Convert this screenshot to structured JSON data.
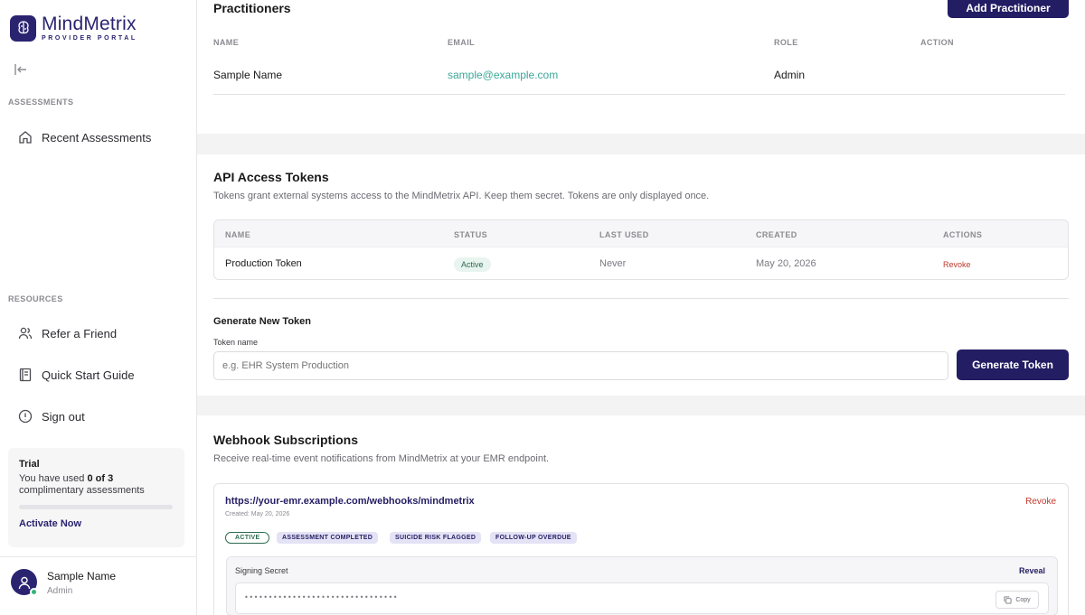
{
  "brand": {
    "name": "MindMetrix",
    "subtitle": "PROVIDER PORTAL"
  },
  "sidebar": {
    "assessments_label": "ASSESSMENTS",
    "recent_assessments": "Recent Assessments",
    "resources_label": "RESOURCES",
    "refer_friend": "Refer a Friend",
    "quick_start": "Quick Start Guide",
    "sign_out": "Sign out",
    "trial": {
      "title": "Trial",
      "text_prefix": "You have used",
      "used": "0 of 3",
      "text_suffix": "complimentary assessments",
      "progress": 0,
      "action": "Activate Now"
    },
    "user": {
      "name": "Sample Name",
      "role": "Admin",
      "status_color": "#2fb57a"
    }
  },
  "practitioners": {
    "title": "Practitioners",
    "add_button": "Add Practitioner",
    "columns": [
      "NAME",
      "EMAIL",
      "ROLE",
      "ACTION"
    ],
    "rows": [
      {
        "name": "Sample Name",
        "email": "sample@example.com",
        "role": "Admin"
      }
    ]
  },
  "tokens": {
    "title": "API Access Tokens",
    "description": "Tokens grant external systems access to the MindMetrix API. Keep them secret. Tokens are only displayed once.",
    "columns": [
      "NAME",
      "STATUS",
      "LAST USED",
      "CREATED",
      "ACTIONS"
    ],
    "rows": [
      {
        "name": "Production Token",
        "status": "Active",
        "last_used": "Never",
        "created": "May 20, 2026",
        "action": "Revoke"
      }
    ],
    "generate": {
      "title": "Generate New Token",
      "field_label": "Token name",
      "placeholder": "e.g. EHR System Production",
      "button": "Generate Token"
    }
  },
  "webhooks": {
    "title": "Webhook Subscriptions",
    "description": "Receive real-time event notifications from MindMetrix at your EMR endpoint.",
    "items": [
      {
        "url": "https://your-emr.example.com/webhooks/mindmetrix",
        "created": "Created: May 20, 2026",
        "revoke": "Revoke",
        "status": "ACTIVE",
        "events": [
          "ASSESSMENT COMPLETED",
          "SUICIDE RISK FLAGGED",
          "FOLLOW-UP OVERDUE"
        ],
        "secret_label": "Signing Secret",
        "reveal": "Reveal",
        "secret_masked": "••••••••••••••••••••••••••••••••",
        "copy": "Copy"
      }
    ]
  },
  "colors": {
    "brand": "#231d63",
    "email_link": "#3aa79a",
    "danger": "#c0392b"
  }
}
